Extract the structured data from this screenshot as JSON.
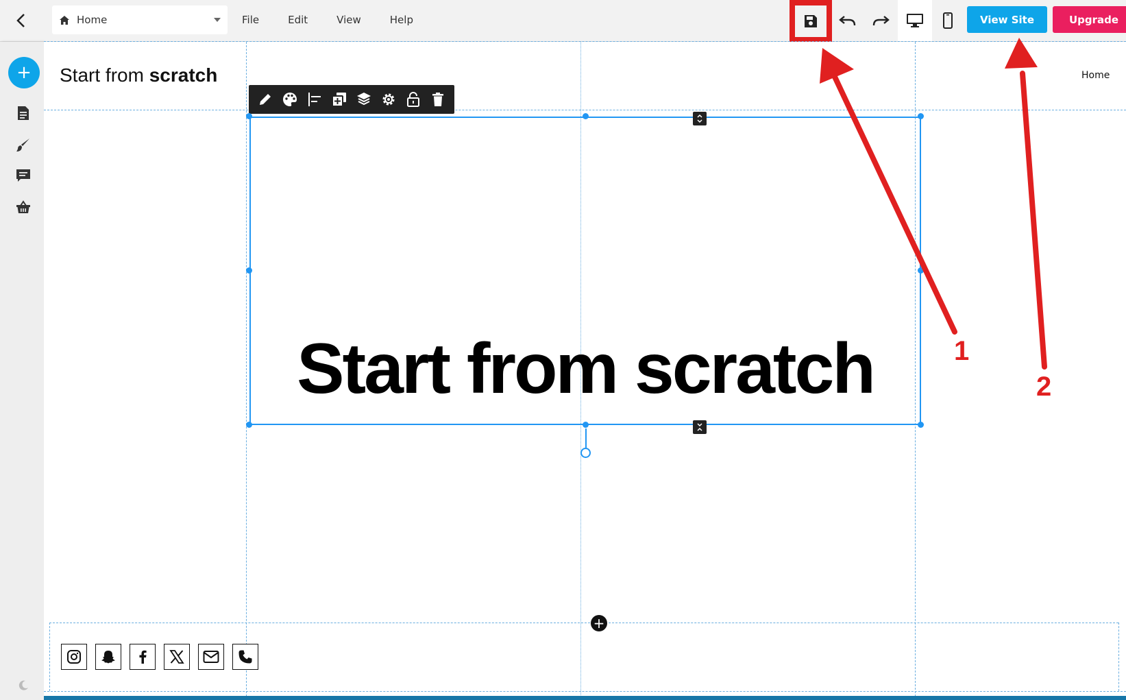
{
  "topbar": {
    "page_select": {
      "icon": "home-icon",
      "label": "Home"
    },
    "menu": [
      "File",
      "Edit",
      "View",
      "Help"
    ],
    "tools": [
      "save-icon",
      "undo-icon",
      "redo-icon",
      "desktop-icon",
      "mobile-icon"
    ],
    "view_site_label": "View Site",
    "upgrade_label": "Upgrade",
    "colors": {
      "view_site": "#0ea5e9",
      "upgrade": "#ea1f5f",
      "selection": "#2196f3"
    }
  },
  "sidebar": {
    "add_label": "+",
    "icons": [
      "page-icon",
      "brush-icon",
      "comments-icon",
      "store-basket-icon",
      "moon-icon"
    ]
  },
  "canvas": {
    "site_title_regular": "Start from",
    "site_title_bold": "scratch",
    "nav_home": "Home",
    "headline": "Start from scratch",
    "element_toolbar": [
      "edit-icon",
      "palette-icon",
      "align-icon",
      "duplicate-icon",
      "layers-icon",
      "settings-icon",
      "lock-icon",
      "delete-icon"
    ],
    "add_section_label": "+",
    "social_icons": [
      "instagram-icon",
      "snapchat-icon",
      "facebook-icon",
      "x-icon",
      "email-icon",
      "phone-icon"
    ]
  },
  "annotations": {
    "label_1": "1",
    "label_2": "2",
    "color": "#e02020"
  }
}
